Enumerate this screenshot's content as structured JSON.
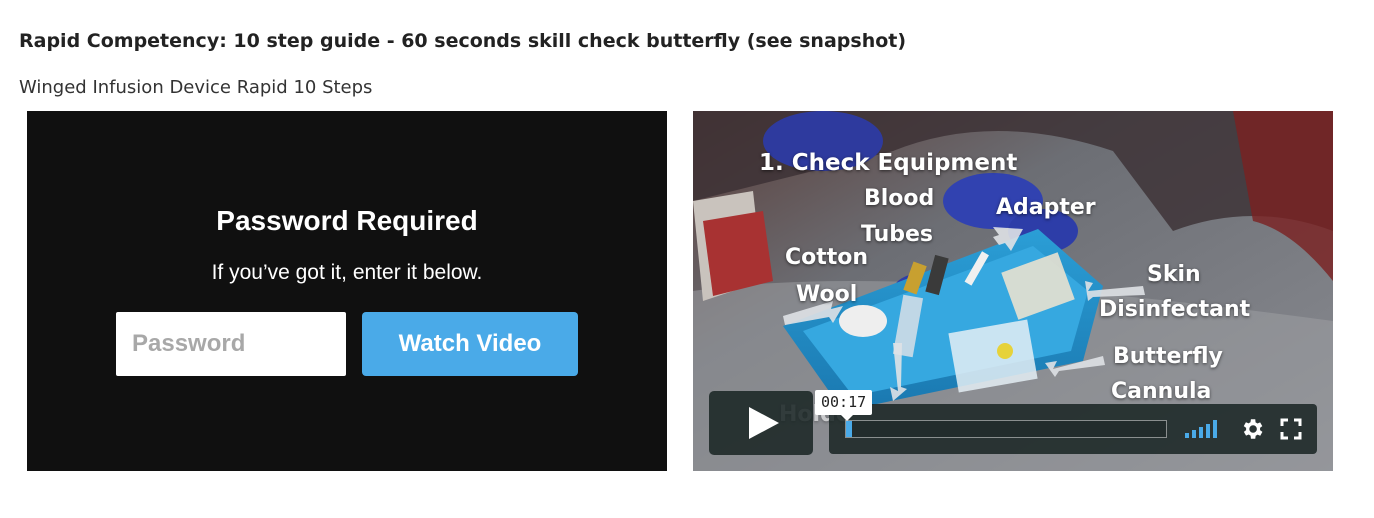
{
  "page": {
    "heading": "Rapid Competency: 10 step guide - 60 seconds skill check butterfly (see snapshot)",
    "subheading": "Winged Infusion Device Rapid 10 Steps"
  },
  "password_gate": {
    "title": "Password Required",
    "subtitle": "If you’ve got it, enter it below.",
    "input_placeholder": "Password",
    "input_value": "",
    "button_label": "Watch Video"
  },
  "video": {
    "overlay_labels": {
      "step": "1. Check Equipment",
      "blood": "Blood",
      "tubes": "Tubes",
      "adapter": "Adapter",
      "cotton": "Cotton",
      "wool": "Wool",
      "skin": "Skin",
      "disinfectant": "Disinfectant",
      "butterfly": "Butterfly",
      "cannula": "Cannula",
      "holder": "Holde"
    },
    "player": {
      "timecode": "00:17",
      "progress": 0.005,
      "play_icon": "play-icon",
      "volume_icon": "volume-bars-icon",
      "settings_icon": "gear-icon",
      "fullscreen_icon": "fullscreen-icon",
      "accent_color": "#4aaae8"
    }
  }
}
